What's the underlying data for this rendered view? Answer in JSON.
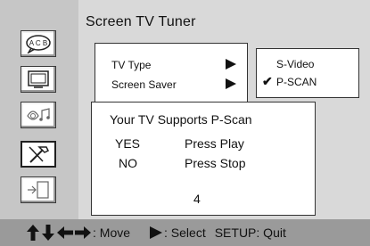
{
  "header": {
    "title": "Screen TV Tuner"
  },
  "sidebar": {
    "items": [
      {
        "icon": "abc-speech-bubble-icon"
      },
      {
        "icon": "tv-monitor-icon"
      },
      {
        "icon": "speaker-music-icon"
      },
      {
        "icon": "hammer-tools-icon"
      },
      {
        "icon": "exit-door-icon"
      }
    ],
    "selected_index": 3
  },
  "menu": {
    "items": [
      {
        "label": "TV Type"
      },
      {
        "label": "Screen Saver"
      }
    ]
  },
  "submenu": {
    "items": [
      {
        "label": "S-Video",
        "checked": false
      },
      {
        "label": "P-SCAN",
        "checked": true
      }
    ],
    "check_glyph": "✔"
  },
  "dialog": {
    "message": "Your TV Supports P-Scan",
    "options": [
      {
        "key": "YES",
        "action": "Press Play"
      },
      {
        "key": "NO",
        "action": "Press Stop"
      }
    ],
    "countdown": "4"
  },
  "footer": {
    "move_label": ": Move",
    "select_label": ": Select",
    "setup_label": "SETUP: Quit"
  }
}
